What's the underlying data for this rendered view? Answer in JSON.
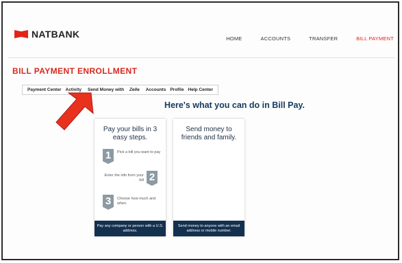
{
  "brand": {
    "name": "NATBANK",
    "accent": "#e2231a"
  },
  "topnav": [
    {
      "label": "HOME"
    },
    {
      "label": "ACCOUNTS"
    },
    {
      "label": "TRANSFER"
    },
    {
      "label": "BILL PAYMENT"
    }
  ],
  "page_title": "BILL PAYMENT ENROLLMENT",
  "subnav": {
    "payment_center": "Payment Center",
    "activity": "Activity",
    "send_money": "Send Money with",
    "zelle": "Zelle",
    "accounts": "Accounts",
    "profile": "Profile",
    "help_center": "Help Center"
  },
  "headline": "Here's what you can do in Bill Pay.",
  "card_pay": {
    "title": "Pay your bills in 3 easy steps.",
    "steps": [
      {
        "num": "1",
        "text": "Pick a bill you want to pay"
      },
      {
        "num": "2",
        "text": "Enter the info from your bill"
      },
      {
        "num": "3",
        "text": "Choose how much and when."
      }
    ],
    "footer": "Pay any company or person with a U.S. address."
  },
  "card_send": {
    "title": "Send money to friends and family.",
    "footer": "Send money to anyone with an email address or mobile number."
  },
  "icons": {
    "logo": "flag-logo-icon",
    "arrow": "red-pointer-arrow-icon"
  }
}
